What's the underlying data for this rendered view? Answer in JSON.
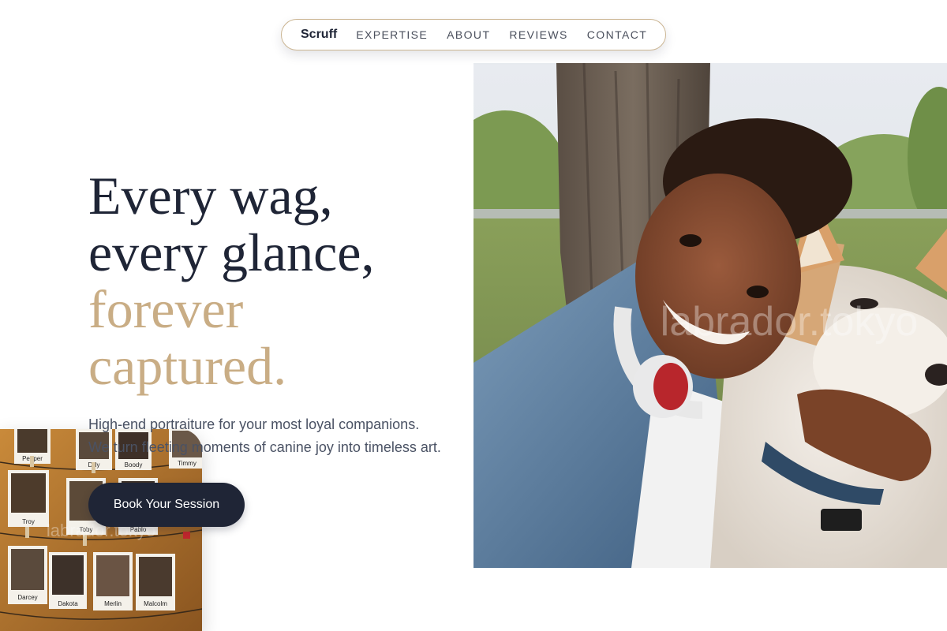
{
  "nav": {
    "brand": "Scruff",
    "links": [
      "EXPERTISE",
      "ABOUT",
      "REVIEWS",
      "CONTACT"
    ]
  },
  "hero": {
    "headline_lines": [
      "Every wag,",
      "every glance,"
    ],
    "headline_accent_lines": [
      "forever",
      "captured."
    ],
    "subtext_lines": [
      "High-end portraiture for your most loyal companions.",
      "We turn fleeting moments of canine joy into timeless art."
    ],
    "cta_label": "Book Your Session"
  },
  "images": {
    "main_watermark": "labrador.tokyo",
    "polaroid_watermark": "labrador.tokyo",
    "polaroid_captions": [
      "Pepper",
      "Dilly",
      "Boody",
      "Timmy",
      "Troy",
      "Toby",
      "Pablo",
      "Darcey",
      "Dakota",
      "Merlin",
      "Malcolm"
    ]
  },
  "colors": {
    "navy": "#1f2536",
    "accent_tan": "#c9ad85",
    "body_text": "#4a5264",
    "nav_border": "#cbb592"
  }
}
